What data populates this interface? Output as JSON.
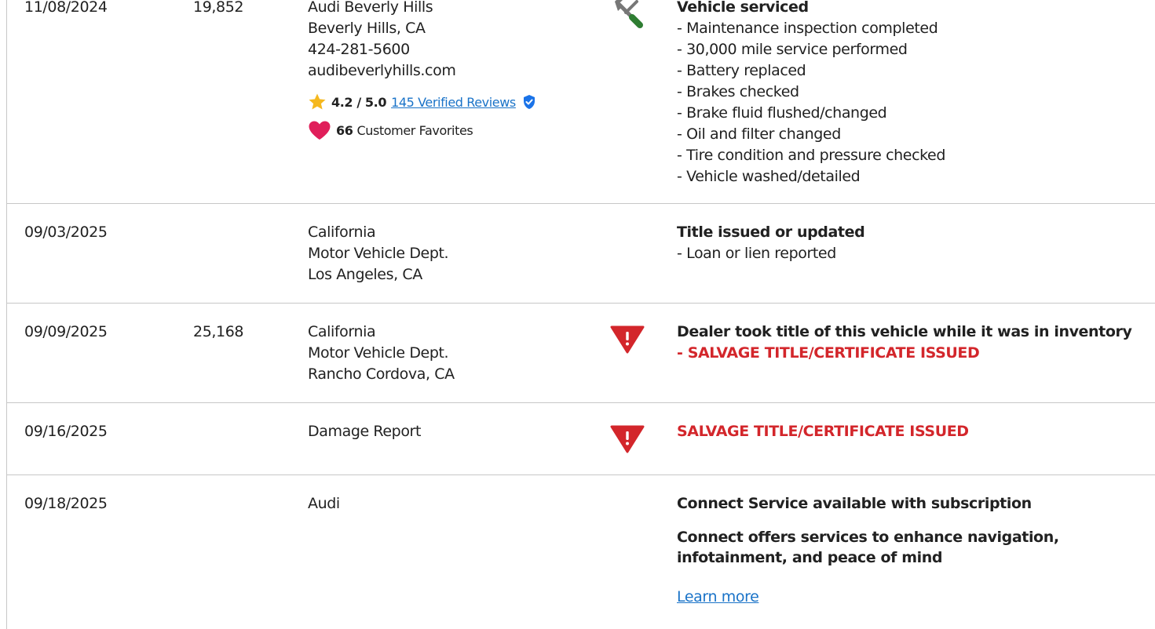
{
  "records": [
    {
      "date": "11/08/2024",
      "mileage": "19,852",
      "source": {
        "lines": [
          "Audi Beverly Hills",
          "Beverly Hills, CA",
          "424-281-5600",
          "audibeverlyhills.com"
        ],
        "rating": {
          "score": "4.2 / 5.0",
          "reviews_link": "145 Verified Reviews"
        },
        "favorites": {
          "count": "66",
          "label": "Customer Favorites"
        }
      },
      "icon": "wrench-screwdriver-icon",
      "title": "Vehicle serviced",
      "items": [
        "- Maintenance inspection completed",
        "- 30,000 mile service performed",
        "- Battery replaced",
        "- Brakes checked",
        "- Brake fluid flushed/changed",
        "- Oil and filter changed",
        "- Tire condition and pressure checked",
        "- Vehicle washed/detailed"
      ]
    },
    {
      "date": "09/03/2025",
      "mileage": "",
      "source": {
        "lines": [
          "California",
          "Motor Vehicle Dept.",
          "Los Angeles, CA"
        ]
      },
      "icon": "",
      "title": "Title issued or updated",
      "items": [
        "- Loan or lien reported"
      ]
    },
    {
      "date": "09/09/2025",
      "mileage": "25,168",
      "source": {
        "lines": [
          "California",
          "Motor Vehicle Dept.",
          "Rancho Cordova, CA"
        ]
      },
      "icon": "warning-triangle-icon",
      "title": "Dealer took title of this vehicle while it was in inventory",
      "alert_items": [
        "- SALVAGE TITLE/CERTIFICATE ISSUED"
      ]
    },
    {
      "date": "09/16/2025",
      "mileage": "",
      "source": {
        "lines": [
          "Damage Report"
        ]
      },
      "icon": "warning-triangle-icon",
      "alert_title": "SALVAGE TITLE/CERTIFICATE ISSUED"
    },
    {
      "date": "09/18/2025",
      "mileage": "",
      "source": {
        "lines": [
          "Audi"
        ]
      },
      "icon": "",
      "title": "Connect Service available with subscription",
      "description_lines": [
        "Connect offers services to enhance navigation,",
        "infotainment, and peace of mind"
      ],
      "link": "Learn more"
    }
  ],
  "colors": {
    "alert": "#d3262b",
    "link": "#1a73c8",
    "heart": "#e01e5a",
    "star": "#f5b81e",
    "verified": "#1a73e8",
    "wrench": "#777777",
    "screwdriver": "#2e7d32",
    "divider": "#c7c7c7"
  }
}
